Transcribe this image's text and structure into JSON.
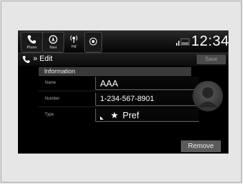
{
  "statusbar": {
    "icons": [
      {
        "label": "Phone",
        "icon": "phone-icon"
      },
      {
        "label": "Navi",
        "icon": "navi-icon"
      },
      {
        "label": "FM",
        "icon": "fm-icon"
      },
      {
        "label": "",
        "icon": "audio-source-icon"
      }
    ],
    "time": "12:34"
  },
  "titlebar": {
    "title": "Edit",
    "save_label": "Save"
  },
  "information": {
    "header": "Information",
    "fields": {
      "name": {
        "label": "Name",
        "value": "AAA"
      },
      "number": {
        "label": "Number",
        "value": "1-234-567-8901"
      },
      "type": {
        "label": "Type",
        "value": "Pref"
      }
    }
  },
  "remove_label": "Remove",
  "colors": {
    "screen_bg": "#000000",
    "button_bg": "#5a5a5a"
  }
}
